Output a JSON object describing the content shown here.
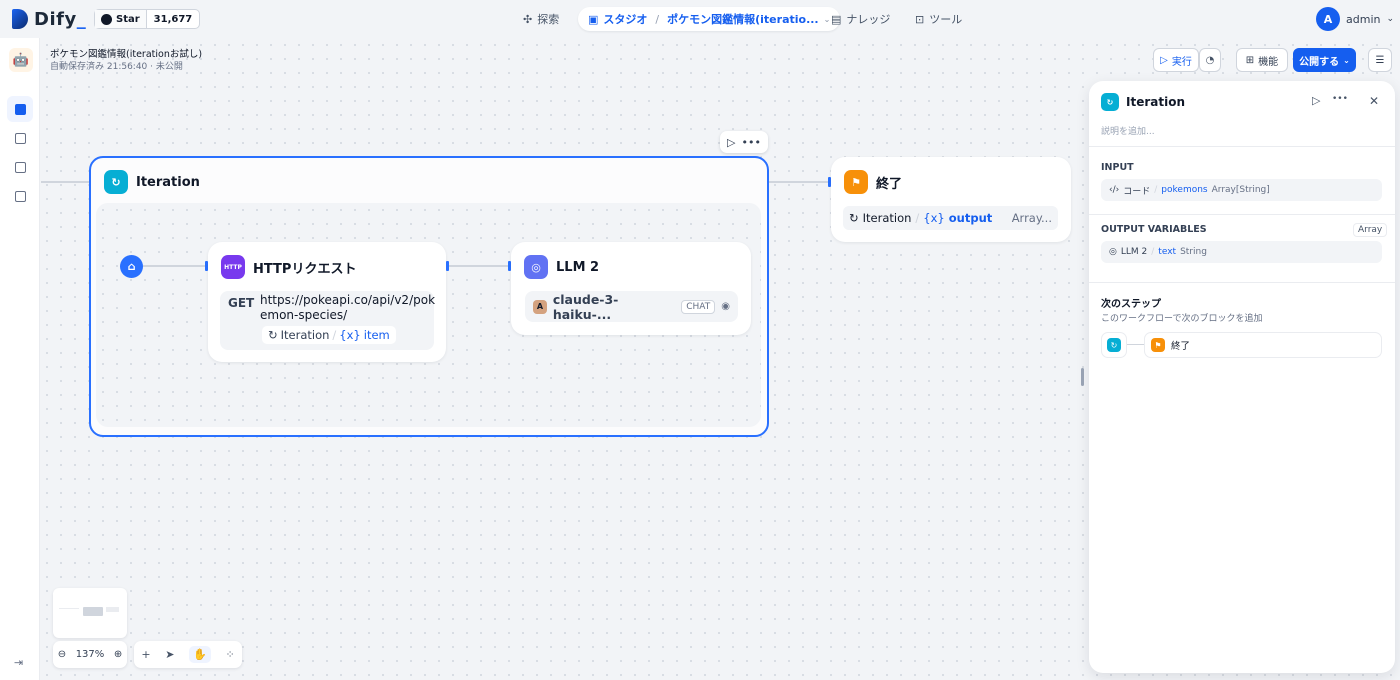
{
  "topbar": {
    "logo_text": "Dify",
    "github_star_label": "Star",
    "github_star_count": "31,677",
    "nav_explore": "探索",
    "nav_studio": "スタジオ",
    "nav_app_name": "ポケモン図鑑情報(iteratio...",
    "nav_knowledge": "ナレッジ",
    "nav_tools": "ツール",
    "user_initial": "A",
    "user_name": "admin"
  },
  "app": {
    "title": "ポケモン図鑑情報(iterationお試し)",
    "status": "自動保存済み 21:56:40 · 未公開"
  },
  "toolbar": {
    "run_label": "実行",
    "features_label": "機能",
    "publish_label": "公開する"
  },
  "nodes": {
    "iteration": {
      "title": "Iteration"
    },
    "http": {
      "title": "HTTPリクエスト",
      "icon_text": "HTTP",
      "method": "GET",
      "url_line1": "https://pokeapi.co/api/v2/pok",
      "url_line2": "emon-species/",
      "var_source": "Iteration",
      "var_name": "item"
    },
    "llm": {
      "title": "LLM 2",
      "model": "claude-3-haiku-...",
      "mode": "CHAT"
    },
    "end": {
      "title": "終了",
      "var_source": "Iteration",
      "var_name": "output",
      "var_type": "Array..."
    }
  },
  "panel": {
    "title": "Iteration",
    "desc_placeholder": "説明を追加...",
    "input_label": "INPUT",
    "input_source": "コード",
    "input_var": "pokemons",
    "input_type": "Array[String]",
    "output_label": "OUTPUT VARIABLES",
    "output_type_tag": "Array",
    "output_source": "LLM 2",
    "output_var": "text",
    "output_type": "String",
    "next_title": "次のステップ",
    "next_sub": "このワークフローで次のブロックを追加",
    "next_node": "終了"
  },
  "zoom": {
    "level": "137%"
  },
  "colors": {
    "accent": "#155eef",
    "iteration": "#06aed4",
    "end": "#f79009",
    "llm": "#6172f3",
    "http": "#7839ee"
  }
}
